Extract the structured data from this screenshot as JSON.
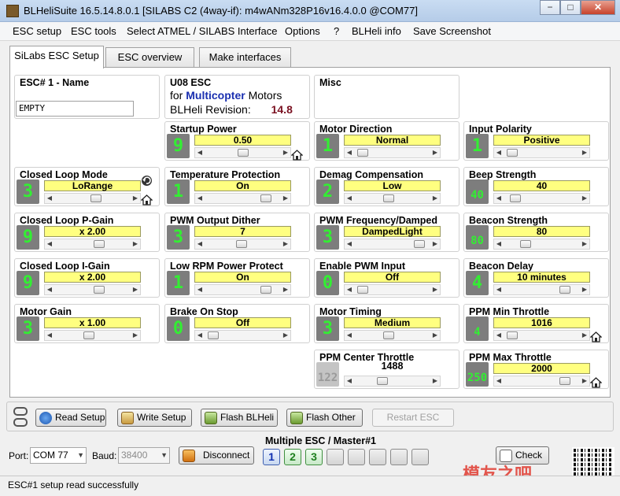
{
  "window": {
    "title": "BLHeliSuite 16.5.14.8.0.1  [SILABS C2 (4way-if): m4wANm328P16v16.4.0.0 @COM77]",
    "min_glyph": "−",
    "max_glyph": "□",
    "close_glyph": "✕"
  },
  "menu": [
    "ESC setup",
    "ESC tools",
    "Select ATMEL / SILABS Interface",
    "Options",
    "?",
    "BLHeli info",
    "Save Screenshot"
  ],
  "tabs": [
    "SiLabs ESC Setup",
    "ESC overview",
    "Make interfaces"
  ],
  "esc_name": {
    "title": "ESC# 1 - Name",
    "value": "EMPTY"
  },
  "firmware": {
    "title": "U08 ESC",
    "for_label": "for",
    "type": "Multicopter",
    "motors_label": "Motors",
    "revision_label": "BLHeli Revision:",
    "revision": "14.8"
  },
  "misc": {
    "title": "Misc"
  },
  "params": {
    "startup_power": {
      "title": "Startup Power",
      "digit": "9",
      "value": "0.50",
      "slider": 0.5
    },
    "motor_direction": {
      "title": "Motor Direction",
      "digit": "1",
      "value": "Normal",
      "slider": 0.05
    },
    "input_polarity": {
      "title": "Input Polarity",
      "digit": "1",
      "value": "Positive",
      "slider": 0.05
    },
    "closed_loop_mode": {
      "title": "Closed Loop Mode",
      "digit": "3",
      "value": "LoRange",
      "slider": 0.55
    },
    "temperature_protection": {
      "title": "Temperature Protection",
      "digit": "1",
      "value": "On",
      "slider": 0.85
    },
    "demag_compensation": {
      "title": "Demag Compensation",
      "digit": "2",
      "value": "Low",
      "slider": 0.45
    },
    "beep_strength": {
      "title": "Beep Strength",
      "digit": "40",
      "value": "40",
      "slider": 0.1
    },
    "closed_loop_p_gain": {
      "title": "Closed Loop P-Gain",
      "digit": "9",
      "value": "x 2.00",
      "slider": 0.6
    },
    "pwm_output_dither": {
      "title": "PWM Output Dither",
      "digit": "3",
      "value": "7",
      "slider": 0.48
    },
    "pwm_frequency_damped": {
      "title": "PWM Frequency/Damped",
      "digit": "3",
      "value": "DampedLight",
      "slider": 0.92
    },
    "beacon_strength": {
      "title": "Beacon Strength",
      "digit": "80",
      "value": "80",
      "slider": 0.25
    },
    "closed_loop_i_gain": {
      "title": "Closed Loop I-Gain",
      "digit": "9",
      "value": "x 2.00",
      "slider": 0.6
    },
    "low_rpm_power_protect": {
      "title": "Low RPM Power Protect",
      "digit": "1",
      "value": "On",
      "slider": 0.85
    },
    "enable_pwm_input": {
      "title": "Enable PWM Input",
      "digit": "0",
      "value": "Off",
      "slider": 0.05
    },
    "beacon_delay": {
      "title": "Beacon Delay",
      "digit": "4",
      "value": "10 minutes",
      "slider": 0.85
    },
    "motor_gain": {
      "title": "Motor Gain",
      "digit": "3",
      "value": "x 1.00",
      "slider": 0.45
    },
    "brake_on_stop": {
      "title": "Brake On Stop",
      "digit": "0",
      "value": "Off",
      "slider": 0.05
    },
    "motor_timing": {
      "title": "Motor Timing",
      "digit": "3",
      "value": "Medium",
      "slider": 0.45
    },
    "ppm_min_throttle": {
      "title": "PPM Min Throttle",
      "digit": "4",
      "value": "1016",
      "slider": 0.05
    },
    "ppm_center_throttle": {
      "title": "PPM Center Throttle",
      "digit": "122",
      "value": "1488",
      "slider": 0.35
    },
    "ppm_max_throttle": {
      "title": "PPM Max Throttle",
      "digit": "250",
      "value": "2000",
      "slider": 0.85
    }
  },
  "buttons": {
    "read_setup": "Read Setup",
    "write_setup": "Write Setup",
    "flash_blheli": "Flash BLHeli",
    "flash_other": "Flash Other",
    "restart_esc": "Restart ESC",
    "disconnect": "Disconnect",
    "check": "Check"
  },
  "port": {
    "port_label": "Port:",
    "port_value": "COM 77",
    "baud_label": "Baud:",
    "baud_value": "38400"
  },
  "multi_esc": {
    "title": "Multiple ESC / Master#1",
    "buttons": [
      "1",
      "2",
      "3",
      "",
      "",
      "",
      "",
      ""
    ]
  },
  "status": "ESC#1 setup read successfully",
  "watermark": "模友之吧"
}
